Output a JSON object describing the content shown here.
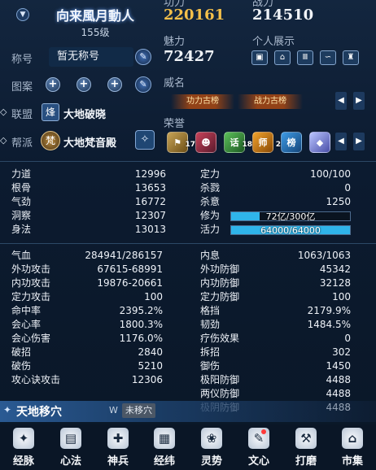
{
  "player": {
    "name": "向来風月動人",
    "level": "155级"
  },
  "header": {
    "left_power_label": "功力",
    "right_power_label": "战力",
    "left_power_value": "220161",
    "right_power_value": "214510",
    "charm_label": "魅力",
    "charm_value": "72427",
    "showcase_label": "个人展示",
    "title_label": "称号",
    "title_value": "暂无称号",
    "pattern_label": "图案",
    "weiming_label": "威名",
    "league_label": "联盟",
    "league_tag": "烽",
    "league_name": "大地破晓",
    "guild_label": "帮派",
    "guild_tag": "梵",
    "guild_name": "大地梵音殿",
    "honor_label": "荣誉",
    "weiming_badges": [
      "功力古榜",
      "战力古榜"
    ],
    "honor_badges": [
      {
        "icon": "flag-icon",
        "count": "17"
      },
      {
        "icon": "mask-icon",
        "count": ""
      },
      {
        "icon": "talk-icon",
        "text": "话",
        "count": "18"
      },
      {
        "icon": "master-icon",
        "text": "师",
        "count": "2"
      },
      {
        "icon": "rank-icon",
        "text": "榜",
        "count": ""
      },
      {
        "icon": "crystal-icon",
        "count": ""
      }
    ]
  },
  "stats_left": [
    {
      "label": "力道",
      "value": "12996"
    },
    {
      "label": "根骨",
      "value": "13653"
    },
    {
      "label": "气劲",
      "value": "16772"
    },
    {
      "label": "洞察",
      "value": "12307"
    },
    {
      "label": "身法",
      "value": "13013"
    }
  ],
  "stats_right": [
    {
      "label": "定力",
      "value": "100/100"
    },
    {
      "label": "杀戮",
      "value": "0"
    },
    {
      "label": "杀意",
      "value": "1250"
    }
  ],
  "progress": [
    {
      "label": "修为",
      "text": "72亿/300亿",
      "fraction": 0.24
    },
    {
      "label": "活力",
      "text": "64000/64000",
      "fraction": 1.0
    }
  ],
  "combat_left": [
    {
      "label": "气血",
      "value": "284941/286157"
    },
    {
      "label": "外功攻击",
      "value": "67615-68991"
    },
    {
      "label": "内功攻击",
      "value": "19876-20661"
    },
    {
      "label": "定力攻击",
      "value": "100"
    },
    {
      "label": "命中率",
      "value": "2395.2%"
    },
    {
      "label": "会心率",
      "value": "1800.3%"
    },
    {
      "label": "会心伤害",
      "value": "1176.0%"
    },
    {
      "label": "破招",
      "value": "2840"
    },
    {
      "label": "破伤",
      "value": "5210"
    },
    {
      "label": "攻心诀攻击",
      "value": "12306"
    }
  ],
  "combat_right": [
    {
      "label": "内息",
      "value": "1063/1063"
    },
    {
      "label": "外功防御",
      "value": "45342"
    },
    {
      "label": "内功防御",
      "value": "32128"
    },
    {
      "label": "定力防御",
      "value": "100"
    },
    {
      "label": "格挡",
      "value": "2179.9%"
    },
    {
      "label": "韧劲",
      "value": "1484.5%"
    },
    {
      "label": "疗伤效果",
      "value": "0"
    },
    {
      "label": "拆招",
      "value": "302"
    },
    {
      "label": "御伤",
      "value": "1450"
    },
    {
      "label": "极阳防御",
      "value": "4488"
    },
    {
      "label": "两仪防御",
      "value": "4488"
    },
    {
      "label": "极阴防御",
      "value": "4488"
    }
  ],
  "tiandi": {
    "title": "天地移穴",
    "key": "W",
    "status": "未移穴"
  },
  "nav": [
    {
      "label": "经脉",
      "icon": "meridian-icon",
      "glyph": "✦"
    },
    {
      "label": "心法",
      "icon": "manual-icon",
      "glyph": "▤"
    },
    {
      "label": "神兵",
      "icon": "weapon-icon",
      "glyph": "✚"
    },
    {
      "label": "经纬",
      "icon": "grid-icon",
      "glyph": "▦"
    },
    {
      "label": "灵势",
      "icon": "spirit-icon",
      "glyph": "❀"
    },
    {
      "label": "文心",
      "icon": "brush-icon",
      "glyph": "✎"
    },
    {
      "label": "打磨",
      "icon": "hammer-icon",
      "glyph": "⚒"
    },
    {
      "label": "市集",
      "icon": "market-icon",
      "glyph": "⌂"
    }
  ],
  "colors": {
    "accent_gold": "#f5c04a",
    "bar_cyan": "#2fb4ea",
    "bg": "#0c1b30"
  }
}
